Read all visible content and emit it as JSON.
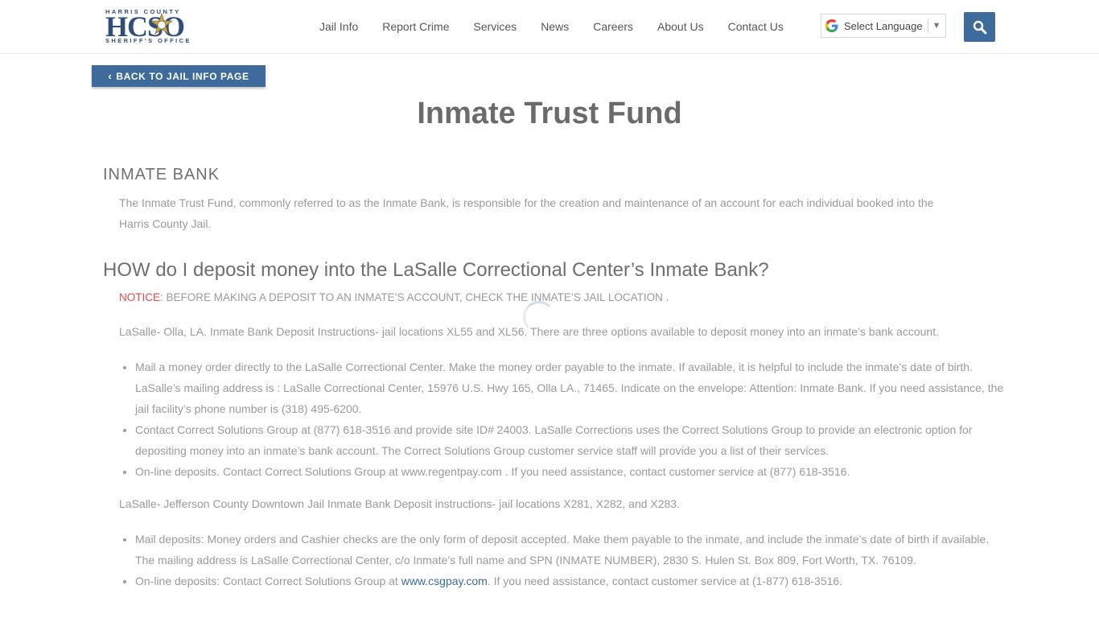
{
  "header": {
    "logo": {
      "top_text": "HARRIS COUNTY",
      "main_text": "HCSO",
      "bottom_text": "SHERIFF'S OFFICE"
    },
    "nav": [
      {
        "label": "Jail Info"
      },
      {
        "label": "Report Crime"
      },
      {
        "label": "Services"
      },
      {
        "label": "News"
      },
      {
        "label": "Careers"
      },
      {
        "label": "About Us"
      },
      {
        "label": "Contact Us"
      }
    ],
    "language_select": {
      "label": "Select Language",
      "arrow": "▼"
    },
    "search_icon": "search-icon"
  },
  "colors": {
    "accent": "#3e6b9b",
    "notice_red": "#e5484d",
    "body_text": "#9a9a9a",
    "heading": "#6b6b6b"
  },
  "back_button": {
    "label": "BACK TO JAIL INFO PAGE",
    "icon": "‹"
  },
  "page": {
    "title": "Inmate Trust Fund",
    "section1": {
      "heading": "INMATE BANK",
      "text": "The Inmate Trust Fund, commonly referred to as the Inmate Bank, is responsible for the creation and maintenance of an account for each individual booked into the Harris County Jail."
    },
    "section2": {
      "heading": "HOW do I deposit money into the LaSalle Correctional Center’s Inmate Bank?",
      "notice_label": "NOTICE",
      "notice_text": ": BEFORE MAKING A DEPOSIT TO AN INMATE’S ACCOUNT, CHECK THE INMATE’S JAIL LOCATION .",
      "olla_intro": "LaSalle- Olla, LA. Inmate Bank Deposit Instructions- jail locations XL55 and XL56. There are three options available to deposit money into an inmate’s bank account.",
      "olla_items": [
        "Mail a money order directly to the LaSalle Correctional Center. Make the money order payable to the inmate. If available, it is helpful to include the inmate’s date of birth. LaSalle’s mailing address is : LaSalle Correctional Center, 15976 U.S. Hwy 165, Olla LA., 71465. Indicate on the envelope: Attention: Inmate Bank. If you need assistance, the jail facility’s phone number is (318) 495-6200.",
        "Contact Correct Solutions Group at (877) 618-3516 and provide site ID# 24003. LaSalle Corrections uses the Correct Solutions Group to provide an electronic option for depositing money into an inmate’s bank account. The Correct Solutions Group customer service staff will provide you a list of their services.",
        "On-line deposits. Contact Correct Solutions Group at www.regentpay.com . If you need assistance, contact customer service at (877) 618-3516."
      ],
      "jefferson_intro": "LaSalle- Jefferson County Downtown Jail Inmate Bank Deposit instructions- jail locations X281, X282, and X283.",
      "jefferson_item1": "Mail deposits: Money orders and Cashier checks are the only form of deposit accepted. Make them payable to the inmate, and include the inmate’s date of birth if available. The mailing address is LaSalle Correctional Center, c/o Inmate’s full name and SPN (INMATE NUMBER), 2830 S. Hulen St. Box 809, Fort Worth, TX. 76109.",
      "jefferson_item2_pre": "On-line deposits: Contact Correct Solutions Group at ",
      "jefferson_item2_link": "www.csgpay.com",
      "jefferson_item2_post": ". If you need assistance, contact customer service at (1-877) 618-3516."
    }
  }
}
